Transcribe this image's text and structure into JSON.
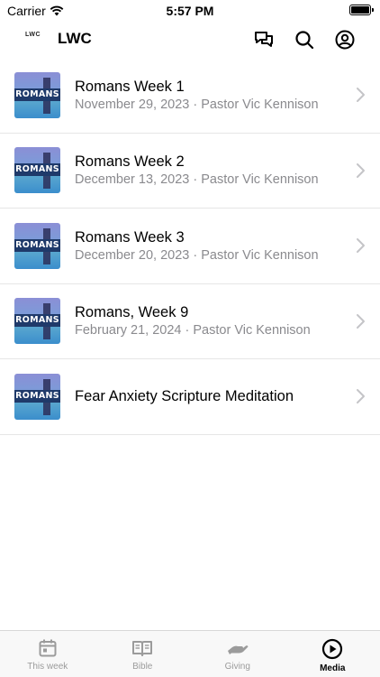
{
  "status": {
    "carrier": "Carrier",
    "time": "5:57 PM"
  },
  "header": {
    "logo": "LWC",
    "title": "LWC"
  },
  "items": [
    {
      "title": "Romans Week 1",
      "subtitle": "November 29, 2023 · Pastor Vic Kennison",
      "thumb": "ROMANS"
    },
    {
      "title": "Romans Week 2",
      "subtitle": "December 13, 2023 · Pastor Vic Kennison",
      "thumb": "ROMANS"
    },
    {
      "title": "Romans Week 3",
      "subtitle": "December 20, 2023 · Pastor Vic Kennison",
      "thumb": "ROMANS"
    },
    {
      "title": "Romans, Week 9",
      "subtitle": "February 21, 2024 · Pastor Vic Kennison",
      "thumb": "ROMANS"
    },
    {
      "title": "Fear Anxiety Scripture Meditation",
      "subtitle": "",
      "thumb": "ROMANS"
    }
  ],
  "tabs": [
    {
      "label": "This week",
      "icon": "calendar-icon"
    },
    {
      "label": "Bible",
      "icon": "book-icon"
    },
    {
      "label": "Giving",
      "icon": "giving-hand-icon"
    },
    {
      "label": "Media",
      "icon": "play-circle-icon"
    }
  ],
  "active_tab": "Media"
}
